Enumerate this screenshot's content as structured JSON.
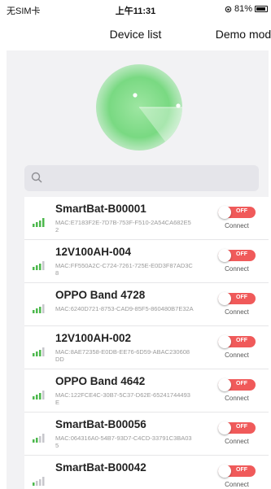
{
  "status": {
    "carrier": "无SIM卡",
    "time": "上午11:31",
    "battery": "81%"
  },
  "nav": {
    "title": "Device list",
    "right_button": "Demo mode"
  },
  "search": {
    "placeholder": "",
    "value": ""
  },
  "devices": [
    {
      "name": "SmartBat-B00001",
      "mac": "MAC:E7183F2E-7D7B-753F-F510-2A54CA682E52",
      "toggle": "OFF",
      "action": "Connect"
    },
    {
      "name": "12V100AH-004",
      "mac": "MAC:FF550A2C-C724-7261-725E-E0D3F87AD3C8",
      "toggle": "OFF",
      "action": "Connect"
    },
    {
      "name": "OPPO Band 4728",
      "mac": "MAC:6240D721-8753-CAD9-85F5-860480B7E32A",
      "toggle": "OFF",
      "action": "Connect"
    },
    {
      "name": "12V100AH-002",
      "mac": "MAC:8AE72358-E0DB-EE76-6D59-ABAC230608DD",
      "toggle": "OFF",
      "action": "Connect"
    },
    {
      "name": "OPPO Band 4642",
      "mac": "MAC:122FCE4C-30B7-5C37-D62E-65241744493E",
      "toggle": "OFF",
      "action": "Connect"
    },
    {
      "name": "SmartBat-B00056",
      "mac": "MAC:064316A0-54B7-93D7-C4CD-33791C3BA035",
      "toggle": "OFF",
      "action": "Connect"
    },
    {
      "name": "SmartBat-B00042",
      "mac": "",
      "toggle": "OFF",
      "action": "Connect"
    }
  ],
  "colors": {
    "toggle_off": "#f05a5a",
    "signal": "#4cb84c",
    "radar": "#6fd37a"
  },
  "icons": {
    "search": "search-icon",
    "signal": "signal-strength-icon",
    "radar": "radar-icon"
  }
}
